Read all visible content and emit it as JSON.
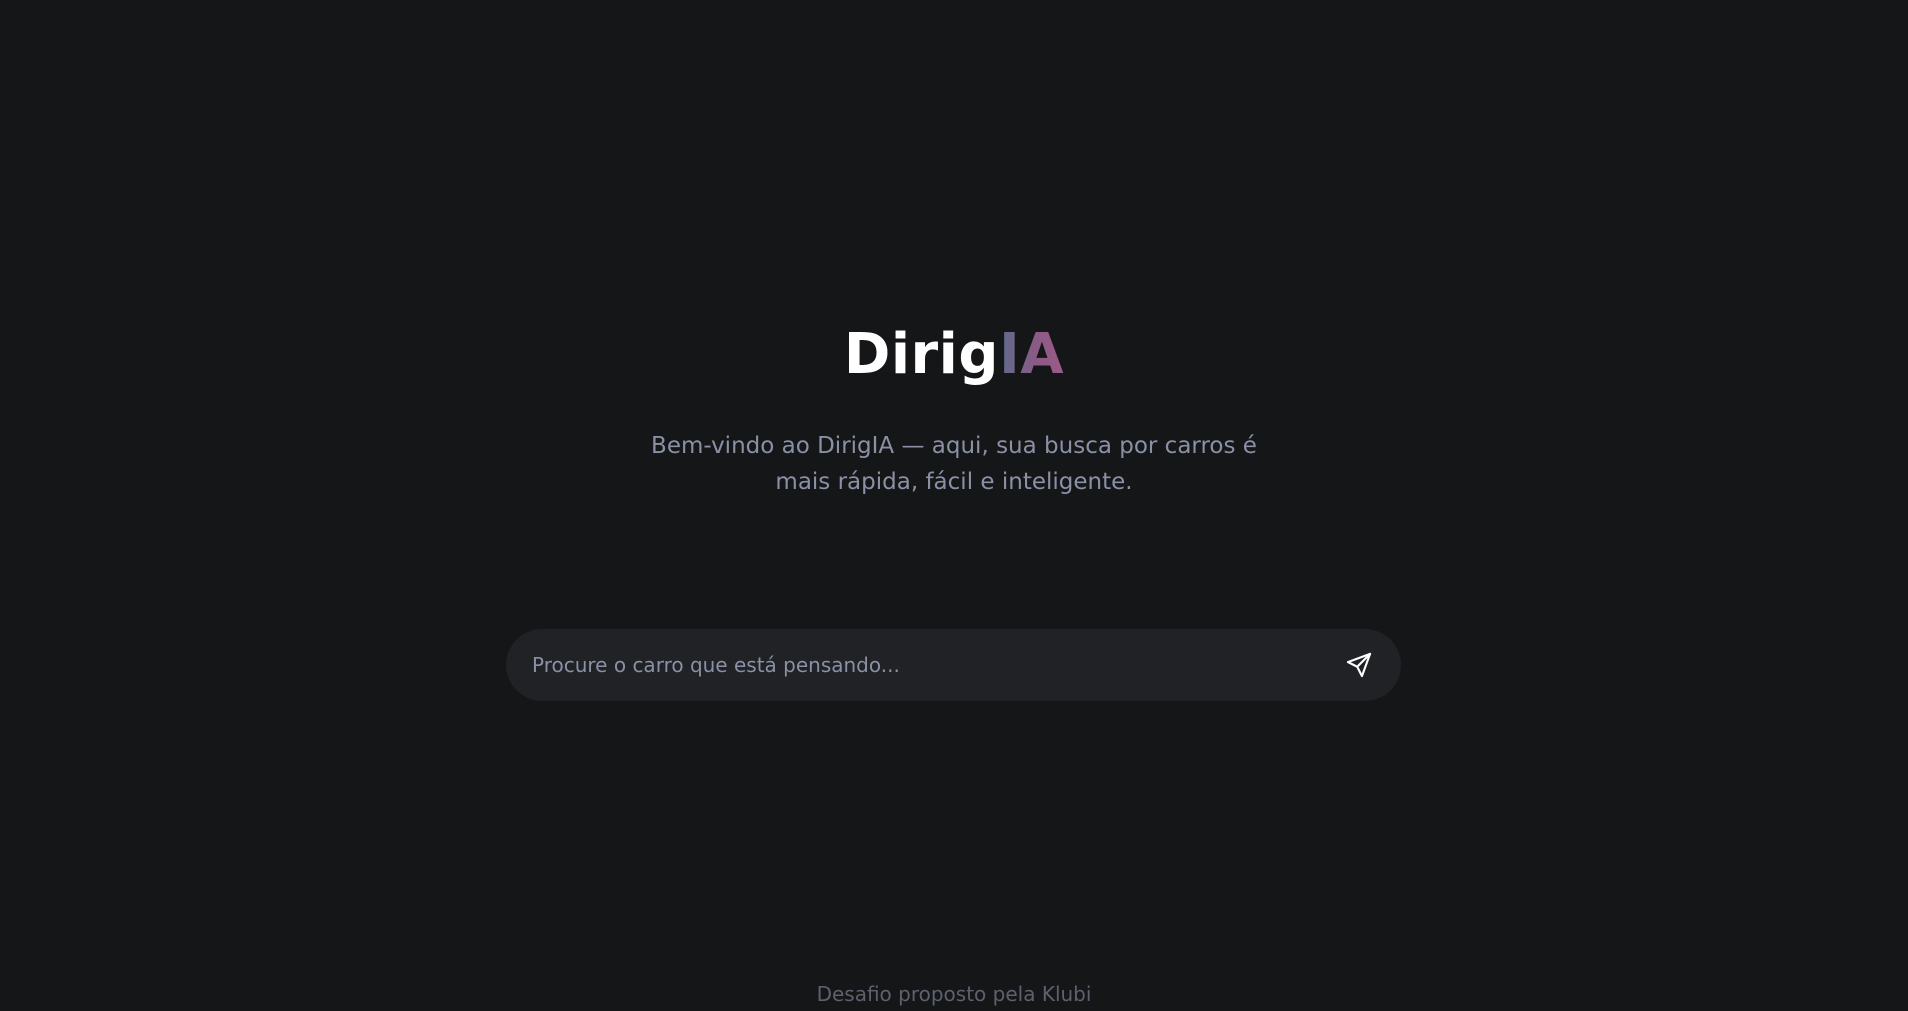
{
  "app": {
    "logo_main": "Dirig",
    "logo_accent": "IA"
  },
  "hero": {
    "subtitle": "Bem-vindo ao DirigIA — aqui, sua busca por carros é mais rápida, fácil e inteligente."
  },
  "search": {
    "value": "",
    "placeholder": "Procure o carro que está pensando...",
    "send_icon": "send-icon"
  },
  "footer": {
    "text": "Desafio proposto pela Klubi"
  },
  "colors": {
    "background": "#151618",
    "input_background": "#212226",
    "logo_gradient_start": "#5d6b8c",
    "logo_gradient_end": "#9c5b88",
    "muted_text": "#8a90a5"
  }
}
